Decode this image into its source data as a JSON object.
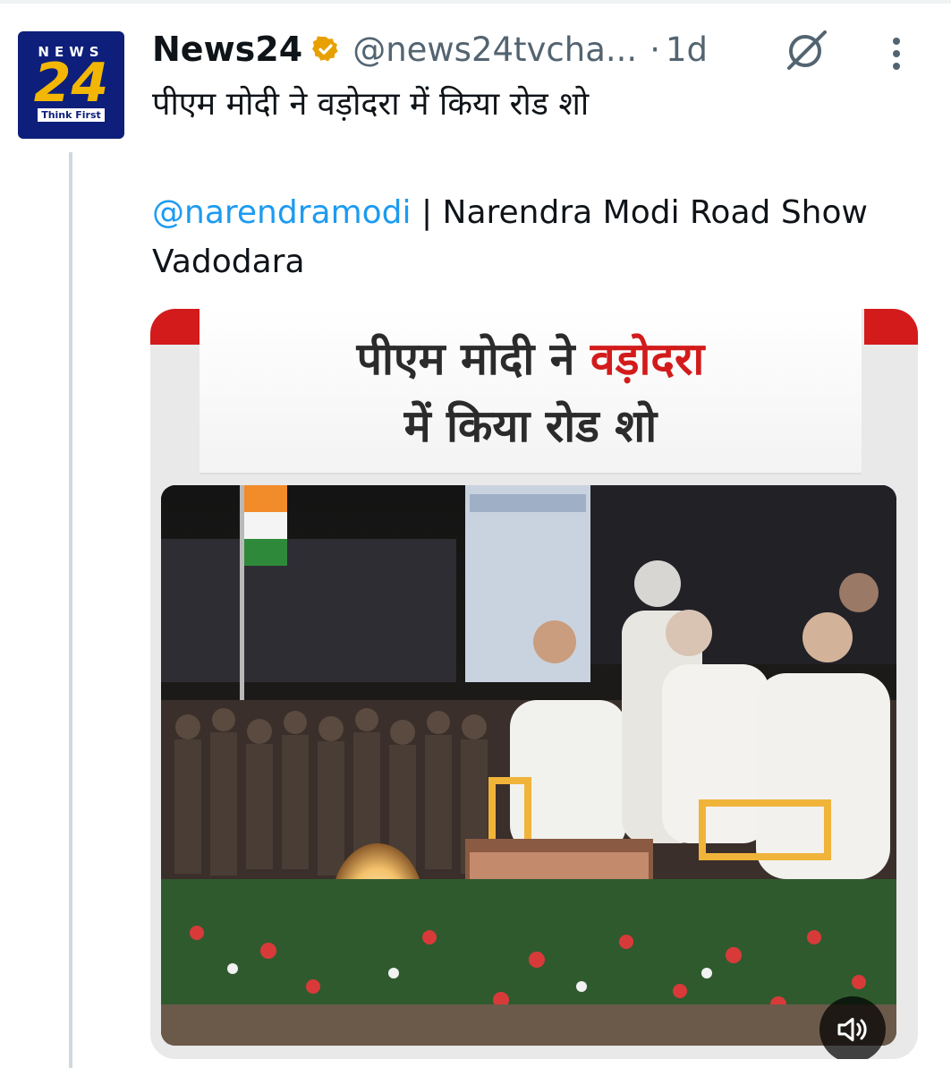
{
  "tweet": {
    "author_name": "News24",
    "handle": "@news24tvcha...",
    "separator": "·",
    "time": "1d",
    "text_hindi": "पीएम मोदी ने वड़ोदरा में किया रोड शो",
    "mention": "@narendramodi",
    "text_english": " | Narendra Modi Road Show Vadodara"
  },
  "avatar": {
    "top": "NEWS",
    "number": "24",
    "tagline": "Think First"
  },
  "media": {
    "headline_part1": "पीएम मोदी ने ",
    "headline_red": "वड़ोदरा",
    "headline_line2": "में किया रोड शो"
  },
  "colors": {
    "link": "#1d9bf0",
    "verified_gold": "#e8a000",
    "muted": "#536471",
    "headline_red": "#d31b1b"
  },
  "icons": [
    "verified-badge-icon",
    "grok-icon",
    "more-options-icon",
    "volume-icon"
  ]
}
